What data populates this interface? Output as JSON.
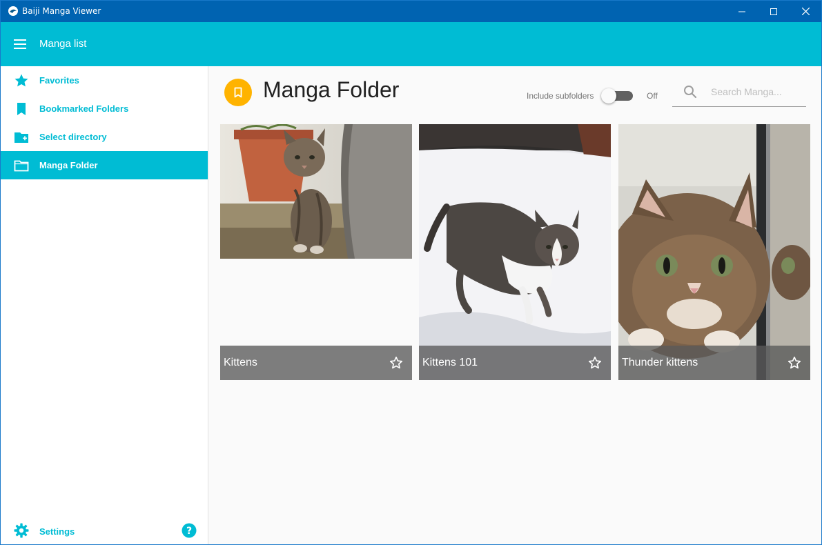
{
  "window": {
    "title": "Baiji Manga Viewer",
    "titlebar_color": "#0063b1"
  },
  "appbar": {
    "title": "Manga list",
    "color": "#00bcd4"
  },
  "sidebar": {
    "items": [
      {
        "label": "Favorites",
        "icon": "star-icon",
        "active": false
      },
      {
        "label": "Bookmarked Folders",
        "icon": "bookmark-icon",
        "active": false
      },
      {
        "label": "Select directory",
        "icon": "folder-add-icon",
        "active": false
      },
      {
        "label": "Manga Folder",
        "icon": "folder-outline-icon",
        "active": true
      }
    ],
    "settings_label": "Settings",
    "help_icon": "help-circle-icon"
  },
  "main": {
    "title": "Manga Folder",
    "badge_icon": "bookmark-outline-icon",
    "badge_color": "#ffb300",
    "toggle_label": "Include subfolders",
    "toggle_state": "Off",
    "search_placeholder": "Search Manga..."
  },
  "cards": [
    {
      "title": "Kittens",
      "favorite": false,
      "image": "kitten-by-flowerpot"
    },
    {
      "title": "Kittens 101",
      "favorite": false,
      "image": "kitten-in-snow"
    },
    {
      "title": "Thunder kittens",
      "favorite": false,
      "image": "kitten-closeup-mirror"
    }
  ]
}
